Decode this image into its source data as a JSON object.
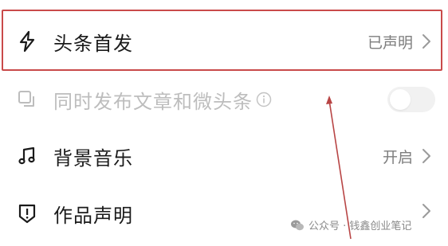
{
  "settings": {
    "items": [
      {
        "label": "头条首发",
        "value": "已声明",
        "icon": "lightning-icon"
      },
      {
        "label": "同时发布文章和微头条",
        "icon": "copy-icon",
        "info_icon": "info-icon",
        "toggle_on": false
      },
      {
        "label": "背景音乐",
        "value": "开启",
        "icon": "music-note-icon"
      },
      {
        "label": "作品声明",
        "value": "",
        "icon": "shield-exclamation-icon"
      }
    ]
  },
  "watermark": {
    "text": "公众号 · 钱鑫创业笔记",
    "icon": "wechat-icon"
  },
  "colors": {
    "highlight": "#c94a4a",
    "label": "#1a1a1a",
    "disabled": "#bdbdbd",
    "value": "#7d7d7d"
  }
}
